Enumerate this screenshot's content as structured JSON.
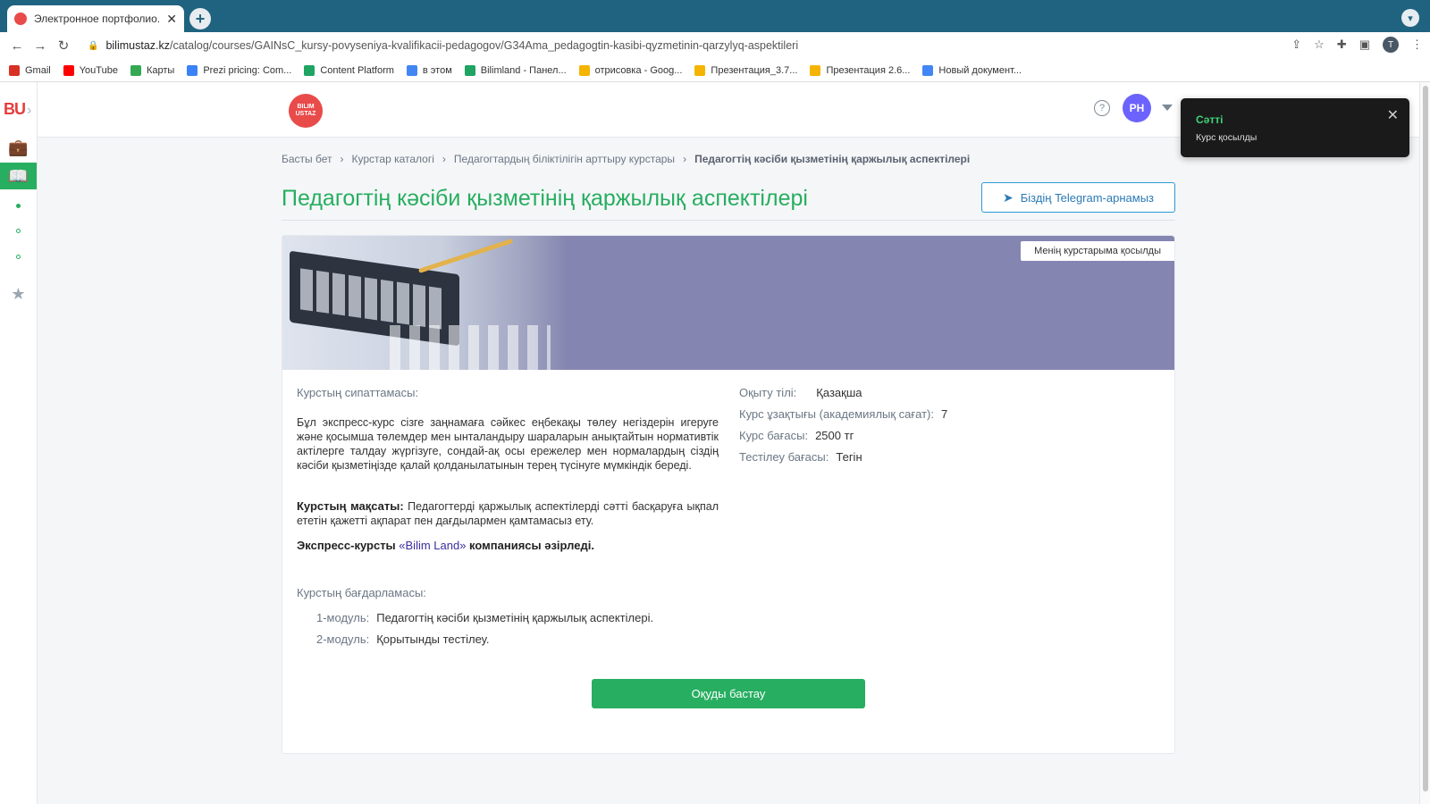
{
  "browser": {
    "tab_title": "Электронное портфолио. Пол",
    "tab_close": "✕",
    "new_tab": "+",
    "url_host": "bilimustaz.kz",
    "url_path": "/catalog/courses/GAINsC_kursy-povyseniya-kvalifikacii-pedagogov/G34Ama_pedagogtin-kasibi-qyzmetinin-qarzylyq-aspektileri",
    "profile_initial": "T",
    "bookmarks": [
      {
        "label": "Gmail",
        "color": "#d93025"
      },
      {
        "label": "YouTube",
        "color": "#ff0000"
      },
      {
        "label": "Карты",
        "color": "#34a853"
      },
      {
        "label": "Prezi pricing: Com...",
        "color": "#3b82f6"
      },
      {
        "label": "Content Platform",
        "color": "#1fa463"
      },
      {
        "label": "в этом",
        "color": "#4285f4"
      },
      {
        "label": "Bilimland - Панел...",
        "color": "#1fa463"
      },
      {
        "label": "отрисовка - Goog...",
        "color": "#f4b400"
      },
      {
        "label": "Презентация_3.7...",
        "color": "#f4b400"
      },
      {
        "label": "Презентация 2.6...",
        "color": "#f4b400"
      },
      {
        "label": "Новый документ...",
        "color": "#4285f4"
      }
    ]
  },
  "sidebar": {
    "logo": "BU"
  },
  "header": {
    "brand_line1": "BILIM",
    "brand_line2": "USTAZ",
    "help": "?",
    "avatar_initials": "PH"
  },
  "breadcrumb": [
    "Басты бет",
    "Курстар каталогі",
    "Педагогтардың біліктілігін арттыру курстары",
    "Педагогтің кәсіби қызметінің қаржылық аспектілері"
  ],
  "page": {
    "title": "Педагогтің кәсіби қызметінің қаржылық аспектілері",
    "telegram_button": "Біздің Telegram-арнамыз",
    "added_badge": "Менің курстарыма қосылды",
    "description_label": "Курстың сипаттамасы:",
    "description": "Бұл экспресс-курс сізге заңнамаға сәйкес еңбекақы төлеу негіздерін игеруге және қосымша төлемдер мен ынталандыру шараларын анықтайтын нормативтік актілерге талдау жүргізуге, сондай-ақ осы ережелер мен нормалардың сіздің кәсіби қызметіңізде қалай қолданылатынын терең түсінуге мүмкіндік береді.",
    "goal_label": "Курстың мақсаты:",
    "goal_text": " Педагогтерді қаржылық аспектілерді сәтті басқаруға ықпал ететін қажетті ақпарат пен дағдылармен қамтамасыз ету.",
    "made_by_prefix": "Экспресс-курсты ",
    "made_by_brand": "«Bilim Land»",
    "made_by_suffix": " компаниясы әзірледі.",
    "program_label": "Курстың бағдарламасы:",
    "modules": [
      {
        "num": "1-модуль:",
        "text": "Педагогтің кәсіби қызметінің қаржылық аспектілері."
      },
      {
        "num": "2-модуль:",
        "text": "Қорытынды тестілеу."
      }
    ],
    "info": [
      {
        "label": "Оқыту тілі:",
        "value": "Қазақша"
      },
      {
        "label": "Курс ұзақтығы (академиялық сағат):",
        "value": "7"
      },
      {
        "label": "Курс бағасы:",
        "value": "2500 тг"
      },
      {
        "label": "Тестілеу бағасы:",
        "value": "Тегін"
      }
    ],
    "start_button": "Оқуды бастау"
  },
  "toast": {
    "title": "Сәтті",
    "message": "Курс қосылды",
    "close": "✕"
  }
}
